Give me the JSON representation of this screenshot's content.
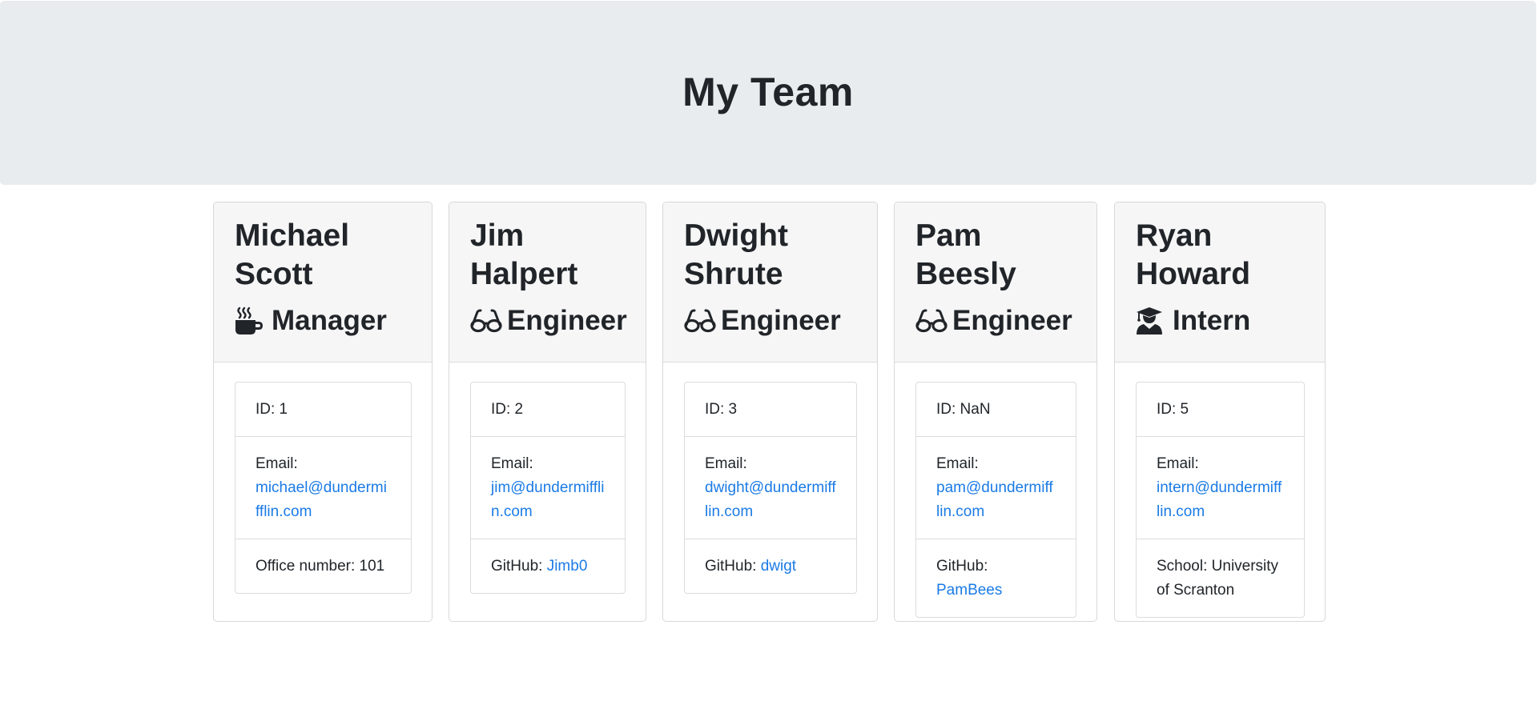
{
  "header": {
    "title": "My Team"
  },
  "employees": [
    {
      "first_name": "Michael",
      "last_name": "Scott",
      "role": "Manager",
      "role_icon": "mug-hot-icon",
      "id_label": "ID: 1",
      "email_label": "Email:",
      "email": "michael@dundermifflin.com",
      "extra_label": "Office number: 101",
      "extra_link": ""
    },
    {
      "first_name": "Jim",
      "last_name": "Halpert",
      "role": "Engineer",
      "role_icon": "glasses-icon",
      "id_label": "ID: 2",
      "email_label": "Email:",
      "email": "jim@dundermifflin.com",
      "extra_label": "GitHub: ",
      "extra_link": "Jimb0"
    },
    {
      "first_name": "Dwight",
      "last_name": "Shrute",
      "role": "Engineer",
      "role_icon": "glasses-icon",
      "id_label": "ID: 3",
      "email_label": "Email:",
      "email": "dwight@dundermifflin.com",
      "extra_label": "GitHub: ",
      "extra_link": "dwigt"
    },
    {
      "first_name": "Pam",
      "last_name": "Beesly",
      "role": "Engineer",
      "role_icon": "glasses-icon",
      "id_label": "ID: NaN",
      "email_label": "Email:",
      "email": "pam@dundermifflin.com",
      "extra_label": "GitHub: ",
      "extra_link": "PamBees"
    },
    {
      "first_name": "Ryan",
      "last_name": "Howard",
      "role": "Intern",
      "role_icon": "user-graduate-icon",
      "id_label": "ID: 5",
      "email_label": "Email:",
      "email": "intern@dundermifflin.com",
      "extra_label": "School: University of Scranton",
      "extra_link": ""
    }
  ],
  "colors": {
    "header_bg": "#e9ecef",
    "card_header_bg": "#f6f6f6",
    "link": "#1b7be5",
    "text": "#212529"
  }
}
